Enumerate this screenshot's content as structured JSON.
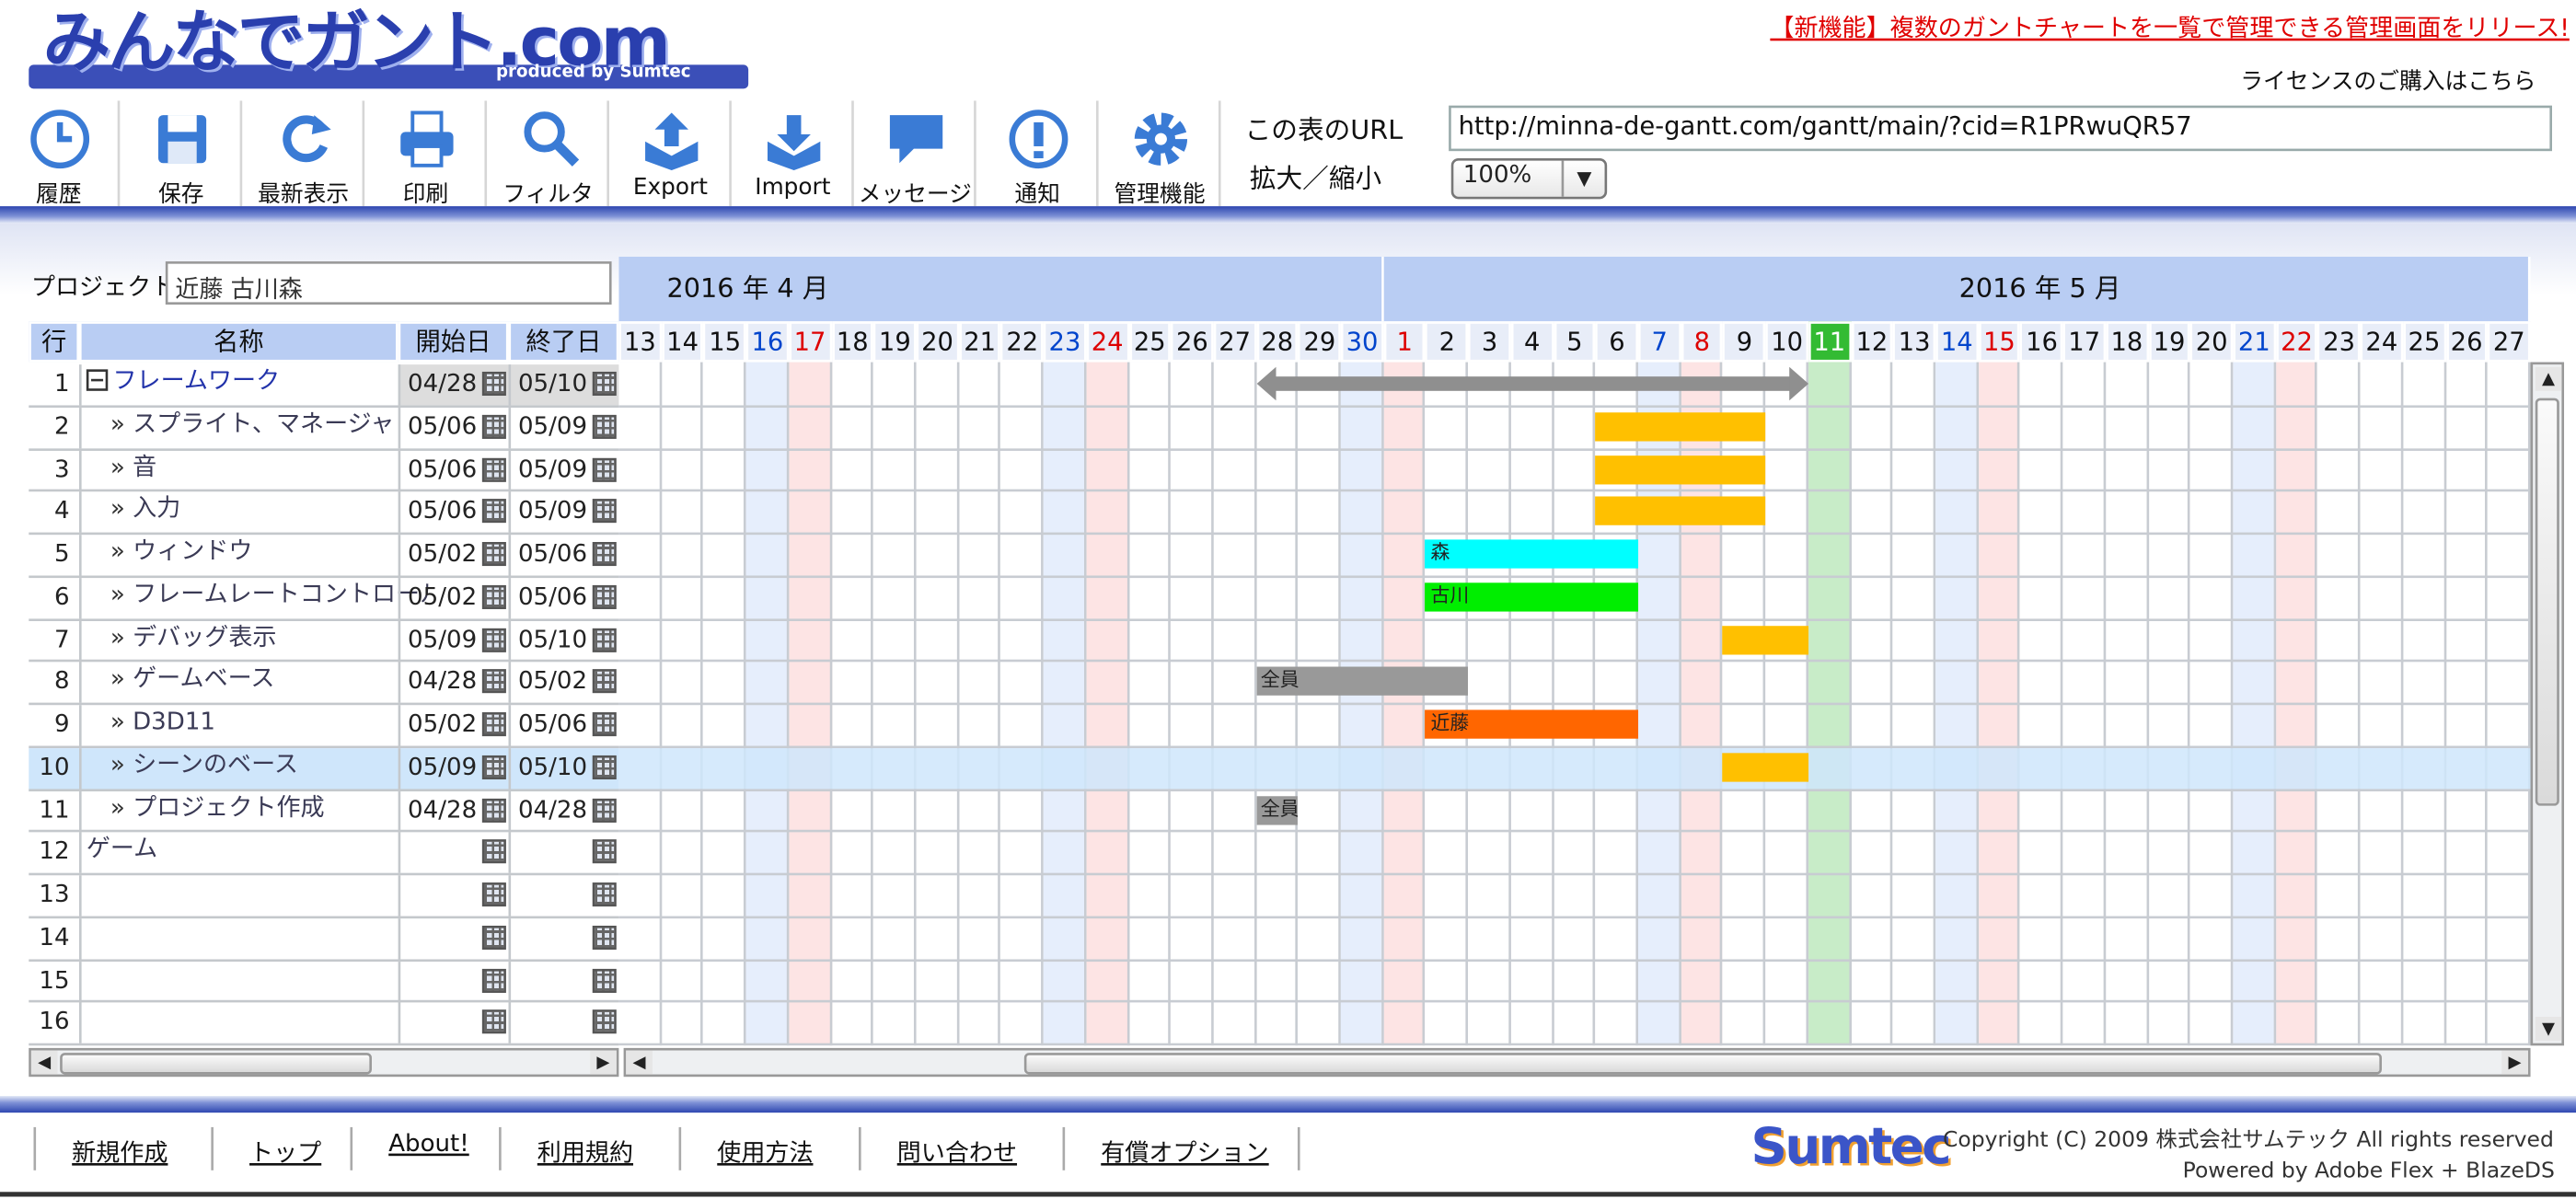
{
  "header": {
    "logo_text": "みんなでガント.com",
    "logo_sub": "produced by Sumtec",
    "announcement": "【新機能】複数のガントチャートを一覧で管理できる管理画面をリリース!",
    "license_link": "ライセンスのご購入はこちら"
  },
  "toolbar": {
    "buttons": [
      {
        "label": "履歴",
        "icon": "clock-icon"
      },
      {
        "label": "保存",
        "icon": "floppy-icon"
      },
      {
        "label": "最新表示",
        "icon": "refresh-icon"
      },
      {
        "label": "印刷",
        "icon": "printer-icon"
      },
      {
        "label": "フィルタ",
        "icon": "search-icon"
      },
      {
        "label": "Export",
        "icon": "export-icon"
      },
      {
        "label": "Import",
        "icon": "import-icon"
      },
      {
        "label": "メッセージ",
        "icon": "speech-bubble-icon"
      },
      {
        "label": "通知",
        "icon": "alert-icon"
      },
      {
        "label": "管理機能",
        "icon": "gear-icon"
      }
    ],
    "url_label": "この表のURL",
    "url_value": "http://minna-de-gantt.com/gantt/main/?cid=R1PRwuQR57",
    "zoom_label": "拡大／縮小",
    "zoom_value": "100%"
  },
  "project": {
    "label": "プロジェクト",
    "members": "近藤 古川森"
  },
  "table": {
    "headers": {
      "row": "行",
      "name": "名称",
      "start": "開始日",
      "end": "終了日"
    },
    "rows": [
      {
        "num": "1",
        "name": "フレームワーク",
        "start": "04/28",
        "end": "05/10",
        "group": true,
        "indent": 0
      },
      {
        "num": "2",
        "name": "スプライト、マネージャ",
        "start": "05/06",
        "end": "05/09",
        "indent": 1
      },
      {
        "num": "3",
        "name": "音",
        "start": "05/06",
        "end": "05/09",
        "indent": 1
      },
      {
        "num": "4",
        "name": "入力",
        "start": "05/06",
        "end": "05/09",
        "indent": 1
      },
      {
        "num": "5",
        "name": "ウィンドウ",
        "start": "05/02",
        "end": "05/06",
        "indent": 1
      },
      {
        "num": "6",
        "name": "フレームレートコントロール",
        "start": "05/02",
        "end": "05/06",
        "indent": 1
      },
      {
        "num": "7",
        "name": "デバッグ表示",
        "start": "05/09",
        "end": "05/10",
        "indent": 1
      },
      {
        "num": "8",
        "name": "ゲームベース",
        "start": "04/28",
        "end": "05/02",
        "indent": 1
      },
      {
        "num": "9",
        "name": "D3D11",
        "start": "05/02",
        "end": "05/06",
        "indent": 1
      },
      {
        "num": "10",
        "name": "シーンのベース",
        "start": "05/09",
        "end": "05/10",
        "indent": 1,
        "selected": true
      },
      {
        "num": "11",
        "name": "プロジェクト作成",
        "start": "04/28",
        "end": "04/28",
        "indent": 1
      },
      {
        "num": "12",
        "name": "ゲーム",
        "start": "",
        "end": "",
        "indent": 0
      },
      {
        "num": "13",
        "name": "",
        "start": "",
        "end": "",
        "indent": 0
      },
      {
        "num": "14",
        "name": "",
        "start": "",
        "end": "",
        "indent": 0
      },
      {
        "num": "15",
        "name": "",
        "start": "",
        "end": "",
        "indent": 0
      },
      {
        "num": "16",
        "name": "",
        "start": "",
        "end": "",
        "indent": 0
      }
    ]
  },
  "gantt": {
    "months": [
      {
        "label": "2016 年 4 月",
        "first_day": "13",
        "last_day": "30"
      },
      {
        "label": "2016 年 5 月",
        "first_day": "1",
        "last_day": "27"
      }
    ],
    "days": [
      {
        "d": "13",
        "t": ""
      },
      {
        "d": "14",
        "t": ""
      },
      {
        "d": "15",
        "t": ""
      },
      {
        "d": "16",
        "t": "sat"
      },
      {
        "d": "17",
        "t": "sun"
      },
      {
        "d": "18",
        "t": ""
      },
      {
        "d": "19",
        "t": ""
      },
      {
        "d": "20",
        "t": ""
      },
      {
        "d": "21",
        "t": ""
      },
      {
        "d": "22",
        "t": ""
      },
      {
        "d": "23",
        "t": "sat"
      },
      {
        "d": "24",
        "t": "sun"
      },
      {
        "d": "25",
        "t": ""
      },
      {
        "d": "26",
        "t": ""
      },
      {
        "d": "27",
        "t": ""
      },
      {
        "d": "28",
        "t": ""
      },
      {
        "d": "29",
        "t": ""
      },
      {
        "d": "30",
        "t": "sat"
      },
      {
        "d": "1",
        "t": "sun"
      },
      {
        "d": "2",
        "t": ""
      },
      {
        "d": "3",
        "t": ""
      },
      {
        "d": "4",
        "t": ""
      },
      {
        "d": "5",
        "t": ""
      },
      {
        "d": "6",
        "t": ""
      },
      {
        "d": "7",
        "t": "sat"
      },
      {
        "d": "8",
        "t": "sun"
      },
      {
        "d": "9",
        "t": ""
      },
      {
        "d": "10",
        "t": ""
      },
      {
        "d": "11",
        "t": "today"
      },
      {
        "d": "12",
        "t": ""
      },
      {
        "d": "13",
        "t": ""
      },
      {
        "d": "14",
        "t": "sat"
      },
      {
        "d": "15",
        "t": "sun"
      },
      {
        "d": "16",
        "t": ""
      },
      {
        "d": "17",
        "t": ""
      },
      {
        "d": "18",
        "t": ""
      },
      {
        "d": "19",
        "t": ""
      },
      {
        "d": "20",
        "t": ""
      },
      {
        "d": "21",
        "t": "sat"
      },
      {
        "d": "22",
        "t": "sun"
      },
      {
        "d": "23",
        "t": ""
      },
      {
        "d": "24",
        "t": ""
      },
      {
        "d": "25",
        "t": ""
      },
      {
        "d": "26",
        "t": ""
      },
      {
        "d": "27",
        "t": ""
      }
    ],
    "bars": [
      {
        "row": 1,
        "start": "04/28",
        "end": "05/10",
        "type": "summary",
        "label": ""
      },
      {
        "row": 2,
        "start": "05/06",
        "end": "05/09",
        "color": "#ffc000",
        "label": ""
      },
      {
        "row": 3,
        "start": "05/06",
        "end": "05/09",
        "color": "#ffc000",
        "label": ""
      },
      {
        "row": 4,
        "start": "05/06",
        "end": "05/09",
        "color": "#ffc000",
        "label": ""
      },
      {
        "row": 5,
        "start": "05/02",
        "end": "05/06",
        "color": "#00ffff",
        "label": "森"
      },
      {
        "row": 6,
        "start": "05/02",
        "end": "05/06",
        "color": "#00ee00",
        "label": "古川"
      },
      {
        "row": 7,
        "start": "05/09",
        "end": "05/10",
        "color": "#ffc000",
        "label": ""
      },
      {
        "row": 8,
        "start": "04/28",
        "end": "05/02",
        "color": "#999999",
        "label": "全員"
      },
      {
        "row": 9,
        "start": "05/02",
        "end": "05/06",
        "color": "#ff6600",
        "label": "近藤"
      },
      {
        "row": 10,
        "start": "05/09",
        "end": "05/10",
        "color": "#ffc000",
        "label": ""
      },
      {
        "row": 11,
        "start": "04/28",
        "end": "04/28",
        "color": "#999999",
        "label": "全員"
      }
    ],
    "colors": {
      "sat": "#0044cc",
      "sun": "#dd0000",
      "today_bg": "#33bb33",
      "sat_bg": "#e6eefc",
      "sun_bg": "#fde4e4",
      "today_col": "#c8ecc8",
      "selected_row": "#cfe6fb"
    }
  },
  "footer": {
    "links": [
      "新規作成",
      "トップ",
      "About!",
      "利用規約",
      "使用方法",
      "問い合わせ",
      "有償オプション"
    ],
    "brand": "Sumtec",
    "copyright": "Copyright (C) 2009 株式会社サムテック All rights reserved",
    "powered": "Powered by Adobe Flex + BlazeDS"
  }
}
